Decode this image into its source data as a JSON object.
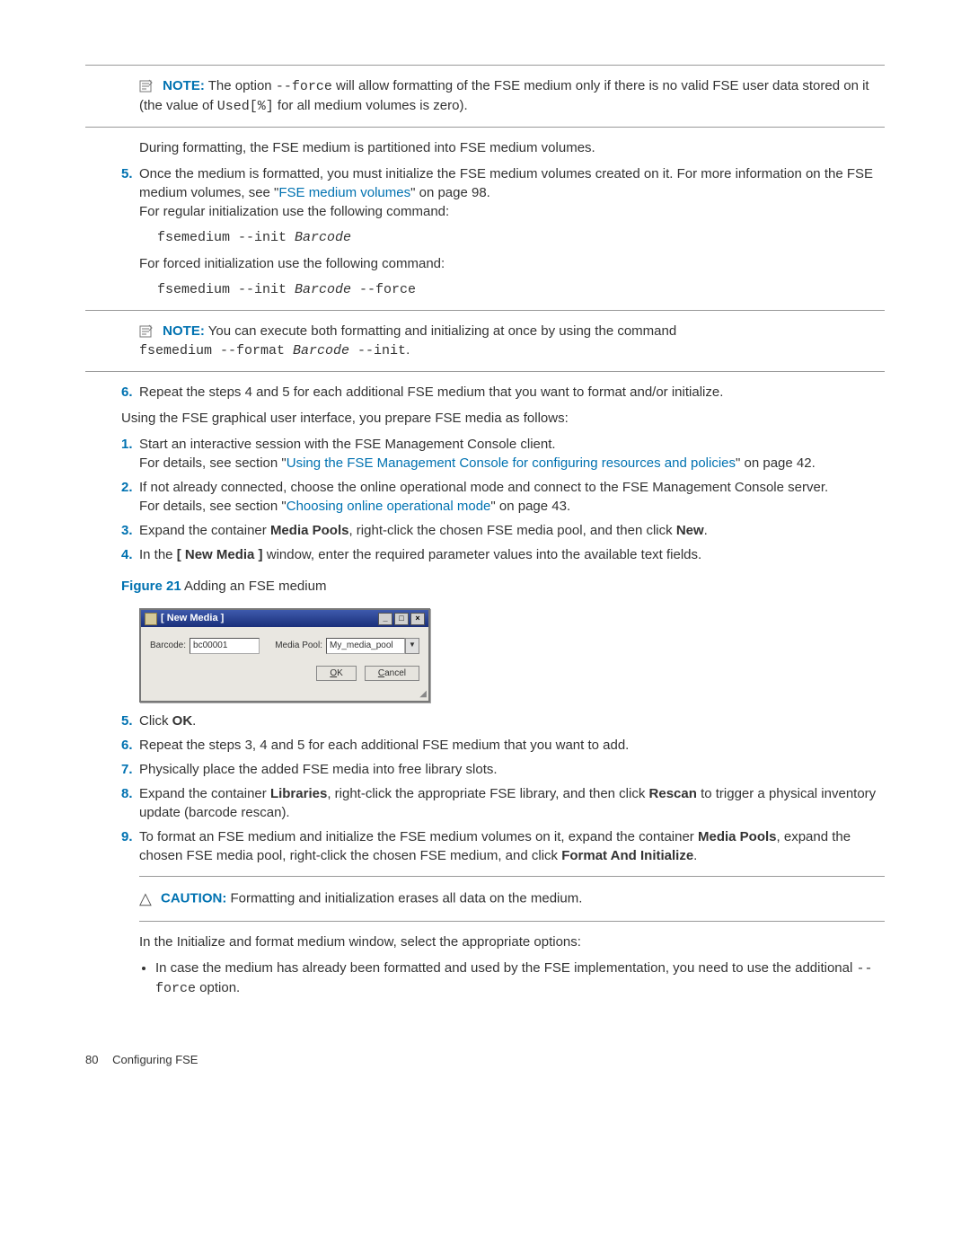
{
  "note1": {
    "label": "NOTE:",
    "text1": "The option ",
    "opt": "--force",
    "text2": " will allow formatting of the FSE medium only if there is no valid FSE user data stored on it (the value of ",
    "used": "Used[%]",
    "text3": " for all medium volumes is zero)."
  },
  "para_formatting": "During formatting, the FSE medium is partitioned into FSE medium volumes.",
  "list1": {
    "item5": {
      "marker": "5.",
      "text1": "Once the medium is formatted, you must initialize the FSE medium volumes created on it. For more information on the FSE medium volumes, see \"",
      "link": "FSE medium volumes",
      "text2": "\" on page 98.",
      "text3": "For regular initialization use the following command:"
    },
    "code1_a": "fsemedium --init ",
    "code1_b": "Barcode",
    "text_forced": "For forced initialization use the following command:",
    "code2_a": "fsemedium --init ",
    "code2_b": "Barcode",
    "code2_c": " --force"
  },
  "note2": {
    "label": "NOTE:",
    "text1": "You can execute both formatting and initializing at once by using the command ",
    "cmd_a": "fsemedium --format ",
    "cmd_b": "Barcode",
    "cmd_c": " --init",
    "dot": "."
  },
  "list1_item6": {
    "marker": "6.",
    "text": "Repeat the steps 4 and 5 for each additional FSE medium that you want to format and/or initialize."
  },
  "para_gui": "Using the FSE graphical user interface, you prepare FSE media as follows:",
  "list2": {
    "i1": {
      "marker": "1.",
      "line1": "Start an interactive session with the FSE Management Console client.",
      "line2a": "For details, see section \"",
      "link": "Using the FSE Management Console for configuring resources and policies",
      "line2b": "\" on page 42."
    },
    "i2": {
      "marker": "2.",
      "line1": "If not already connected, choose the online operational mode and connect to the FSE Management Console server.",
      "line2a": "For details, see section \"",
      "link": "Choosing online operational mode",
      "line2b": "\" on page 43."
    },
    "i3": {
      "marker": "3.",
      "a": "Expand the container ",
      "b": "Media Pools",
      "c": ", right-click the chosen FSE media pool, and then click ",
      "d": "New",
      "e": "."
    },
    "i4": {
      "marker": "4.",
      "a": "In the ",
      "b": "[ New Media ]",
      "c": " window, enter the required parameter values into the available text fields."
    }
  },
  "figure": {
    "label": "Figure 21",
    "caption": " Adding an FSE medium"
  },
  "dialog": {
    "title": "[ New Media ]",
    "min": "_",
    "max": "□",
    "close": "×",
    "barcode_label": "Barcode:",
    "barcode_value": "bc00001",
    "pool_label": "Media Pool:",
    "pool_value": "My_media_pool",
    "ok_u": "O",
    "ok_rest": "K",
    "cancel_u": "C",
    "cancel_rest": "ancel"
  },
  "list3": {
    "i5": {
      "marker": "5.",
      "a": "Click ",
      "b": "OK",
      "c": "."
    },
    "i6": {
      "marker": "6.",
      "text": "Repeat the steps 3, 4 and 5 for each additional FSE medium that you want to add."
    },
    "i7": {
      "marker": "7.",
      "text": "Physically place the added FSE media into free library slots."
    },
    "i8": {
      "marker": "8.",
      "a": "Expand the container ",
      "b": "Libraries",
      "c": ", right-click the appropriate FSE library, and then click ",
      "d": "Rescan",
      "e": " to trigger a physical inventory update (barcode rescan)."
    },
    "i9": {
      "marker": "9.",
      "a": "To format an FSE medium and initialize the FSE medium volumes on it, expand the container ",
      "b": "Media Pools",
      "c": ", expand the chosen FSE media pool, right-click the chosen FSE medium, and click ",
      "d": "Format And Initialize",
      "e": "."
    }
  },
  "caution": {
    "label": "CAUTION:",
    "text": "Formatting and initialization erases all data on the medium."
  },
  "para_init": "In the Initialize and format medium window, select the appropriate options:",
  "bullet1": {
    "a": "In case the medium has already been formatted and used by the FSE implementation, you need to use the additional ",
    "b": "--force",
    "c": " option."
  },
  "footer": {
    "page": "80",
    "section": "Configuring FSE"
  }
}
